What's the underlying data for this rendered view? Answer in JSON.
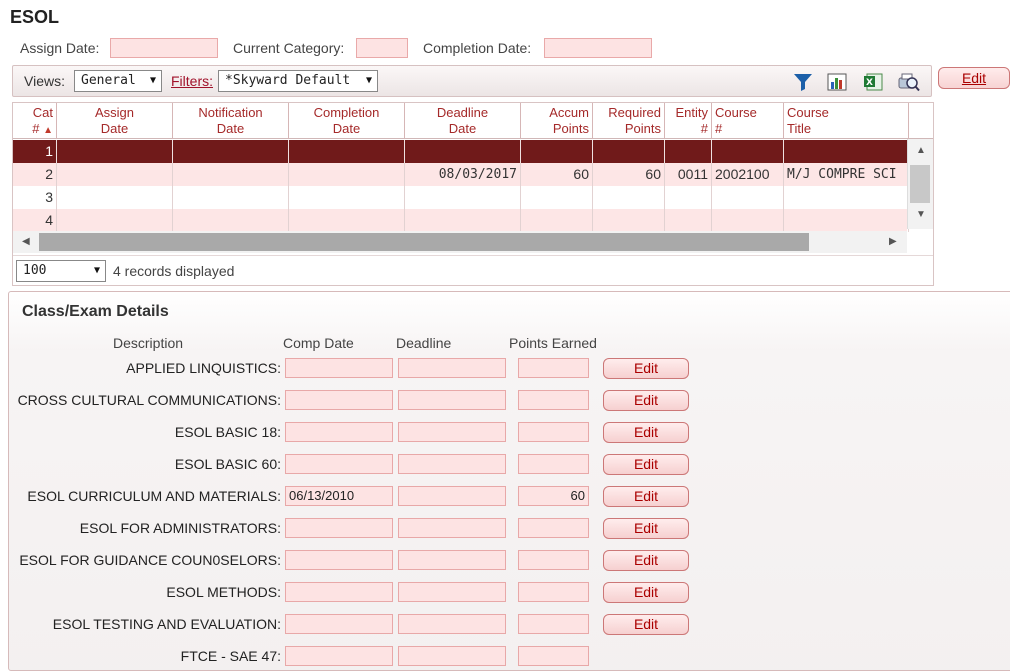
{
  "page": {
    "title": "ESOL",
    "fields": {
      "assign_date_label": "Assign Date:",
      "assign_date_value": "",
      "current_category_label": "Current Category:",
      "current_category_value": "",
      "completion_date_label": "Completion Date:",
      "completion_date_value": ""
    },
    "edit_button": "Edit"
  },
  "toolbar": {
    "views_label": "Views:",
    "views_value": "General",
    "filters_label": "Filters:",
    "filters_value": "*Skyward Default",
    "icons": [
      "filter-icon",
      "chart-icon",
      "excel-icon",
      "print-preview-icon"
    ]
  },
  "grid": {
    "columns": [
      {
        "line1": "Cat",
        "line2": "#"
      },
      {
        "line1": "Assign",
        "line2": "Date"
      },
      {
        "line1": "Notification",
        "line2": "Date"
      },
      {
        "line1": "Completion",
        "line2": "Date"
      },
      {
        "line1": "Deadline",
        "line2": "Date"
      },
      {
        "line1": "Accum",
        "line2": "Points"
      },
      {
        "line1": "Required",
        "line2": "Points"
      },
      {
        "line1": "Entity",
        "line2": "#"
      },
      {
        "line1": "Course",
        "line2": "#"
      },
      {
        "line1": "Course",
        "line2": "Title"
      }
    ],
    "rows": [
      [
        "1",
        "",
        "",
        "",
        "",
        "",
        "",
        "",
        "",
        ""
      ],
      [
        "2",
        "",
        "",
        "",
        "08/03/2017",
        "60",
        "60",
        "0011",
        "2002100",
        "M/J COMPRE SCI"
      ],
      [
        "3",
        "",
        "",
        "",
        "",
        "",
        "",
        "",
        "",
        ""
      ],
      [
        "4",
        "",
        "",
        "",
        "",
        "",
        "",
        "",
        "",
        ""
      ]
    ],
    "page_size": "100",
    "records_text": "4 records displayed"
  },
  "details": {
    "title": "Class/Exam Details",
    "headers": {
      "description": "Description",
      "comp_date": "Comp Date",
      "deadline": "Deadline",
      "points_earned": "Points Earned"
    },
    "edit_label": "Edit",
    "rows": [
      {
        "label": "APPLIED LINQUISTICS:",
        "comp_date": "",
        "deadline": "",
        "points": ""
      },
      {
        "label": "CROSS CULTURAL COMMUNICATIONS:",
        "comp_date": "",
        "deadline": "",
        "points": ""
      },
      {
        "label": "ESOL BASIC 18:",
        "comp_date": "",
        "deadline": "",
        "points": ""
      },
      {
        "label": "ESOL BASIC 60:",
        "comp_date": "",
        "deadline": "",
        "points": ""
      },
      {
        "label": "ESOL CURRICULUM AND MATERIALS:",
        "comp_date": "06/13/2010",
        "deadline": "",
        "points": "60"
      },
      {
        "label": "ESOL FOR ADMINISTRATORS:",
        "comp_date": "",
        "deadline": "",
        "points": ""
      },
      {
        "label": "ESOL FOR GUIDANCE COUN0SELORS:",
        "comp_date": "",
        "deadline": "",
        "points": ""
      },
      {
        "label": "ESOL METHODS:",
        "comp_date": "",
        "deadline": "",
        "points": ""
      },
      {
        "label": "ESOL TESTING AND EVALUATION:",
        "comp_date": "",
        "deadline": "",
        "points": ""
      },
      {
        "label": "FTCE - SAE 47:",
        "comp_date": "",
        "deadline": "",
        "points": ""
      }
    ]
  },
  "colors": {
    "accent": "#a52a2a",
    "selected_row": "#701a1a",
    "field_pink": "#fde3e3"
  }
}
